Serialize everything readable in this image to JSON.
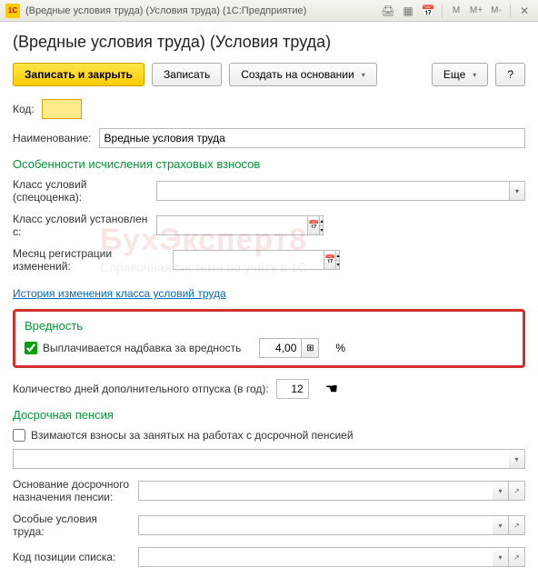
{
  "titlebar": {
    "logo": "1C",
    "title": "(Вредные условия труда) (Условия труда) (1С:Предприятие)"
  },
  "page_title": "(Вредные условия труда) (Условия труда)",
  "toolbar": {
    "save_close": "Записать и закрыть",
    "save": "Записать",
    "create_based": "Создать на основании",
    "more": "Еще",
    "help": "?"
  },
  "fields": {
    "code_label": "Код:",
    "code_value": "",
    "name_label": "Наименование:",
    "name_value": "Вредные условия труда"
  },
  "section_insurance": "Особенности исчисления страховых взносов",
  "insurance": {
    "class_label": "Класс условий (спецоценка):",
    "class_value": "",
    "class_date_label": "Класс условий установлен с:",
    "class_date_value": "",
    "reg_month_label": "Месяц регистрации изменений:",
    "reg_month_value": ""
  },
  "history_link": "История изменения класса условий труда",
  "harm": {
    "section": "Вредность",
    "checkbox_label": "Выплачивается надбавка за вредность",
    "value": "4,00",
    "pct": "%"
  },
  "vacation": {
    "label": "Количество дней дополнительного отпуска (в год):",
    "value": "12"
  },
  "section_pension": "Досрочная пенсия",
  "pension": {
    "checkbox_label": "Взимаются взносы за занятых на работах с досрочной пенсией",
    "dropdown_value": "",
    "basis_label": "Основание досрочного назначения пенсии:",
    "basis_value": "",
    "special_label": "Особые условия труда:",
    "special_value": "",
    "position_label": "Код позиции списка:",
    "position_value": ""
  },
  "watermark": {
    "title": "БухЭксперт8",
    "sub": "Справочная система по учёту в 1С"
  }
}
